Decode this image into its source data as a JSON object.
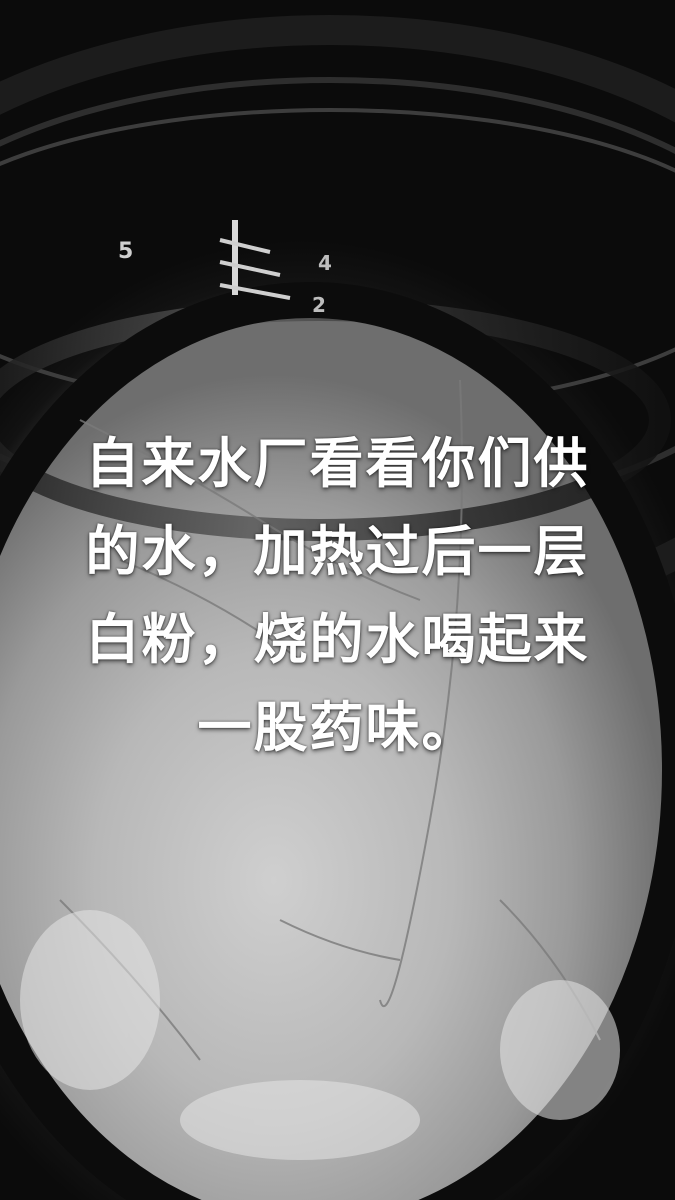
{
  "caption": {
    "lines": [
      "自来水厂看看你们供",
      "的水，加热过后一层",
      "白粉，烧的水喝起来",
      "一股药味。"
    ]
  },
  "scale_marks": {
    "left": "5",
    "right_top": "4",
    "right_bottom": "2"
  }
}
